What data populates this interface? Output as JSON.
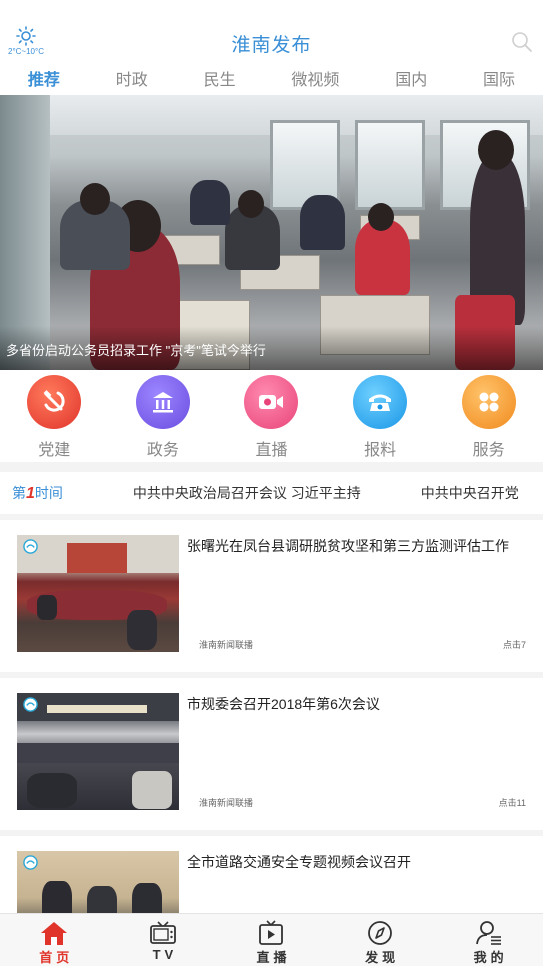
{
  "header": {
    "title": "淮南发布",
    "weather_temp": "2°C~10°C"
  },
  "tabs": [
    {
      "label": "推荐",
      "active": true
    },
    {
      "label": "时政",
      "active": false
    },
    {
      "label": "民生",
      "active": false
    },
    {
      "label": "微视频",
      "active": false
    },
    {
      "label": "国内",
      "active": false
    },
    {
      "label": "国际",
      "active": false
    }
  ],
  "banner": {
    "caption": "多省份启动公务员招录工作 \"京考\"笔试今举行"
  },
  "quick": [
    {
      "label": "党建",
      "icon": "hammer-sickle-icon",
      "color": "#e8473b"
    },
    {
      "label": "政务",
      "icon": "government-building-icon",
      "color": "#7a5ce8"
    },
    {
      "label": "直播",
      "icon": "video-camera-icon",
      "color": "#f0568a"
    },
    {
      "label": "报料",
      "icon": "telephone-icon",
      "color": "#2aa8ef"
    },
    {
      "label": "服务",
      "icon": "grid-services-icon",
      "color": "#f8a23a"
    }
  ],
  "ticker": {
    "label_pre": "第",
    "label_num": "1",
    "label_post": "时间",
    "items": [
      "中共中央政治局召开会议 习近平主持",
      "中共中央召开党"
    ]
  },
  "news": [
    {
      "title": "张曙光在凤台县调研脱贫攻坚和第三方监测评估工作",
      "source": "淮南新闻联播",
      "clicks": "点击7"
    },
    {
      "title": "市规委会召开2018年第6次会议",
      "source": "淮南新闻联播",
      "clicks": "点击11"
    },
    {
      "title": "全市道路交通安全专题视频会议召开",
      "source": "",
      "clicks": ""
    }
  ],
  "tabbar": [
    {
      "label": "首页",
      "icon": "home-icon",
      "active": true
    },
    {
      "label": "TV",
      "icon": "tv-icon",
      "active": false
    },
    {
      "label": "直播",
      "icon": "live-play-icon",
      "active": false
    },
    {
      "label": "发现",
      "icon": "compass-icon",
      "active": false
    },
    {
      "label": "我的",
      "icon": "user-icon",
      "active": false
    }
  ],
  "colors": {
    "accent": "#3a8fd6",
    "active_red": "#e0342b"
  }
}
